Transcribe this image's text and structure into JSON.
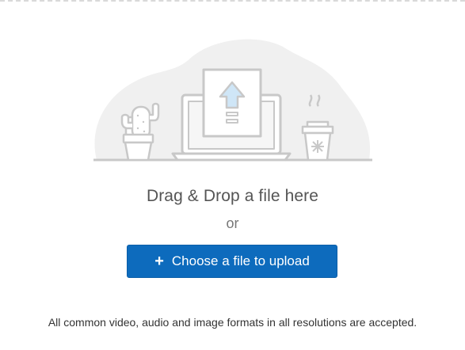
{
  "dropzone": {
    "headline": "Drag & Drop a file here",
    "separator": "or",
    "upload_button_label": "Choose a file to upload",
    "upload_button_icon": "plus-icon",
    "accepted_formats_note": "All common video, audio and image formats in all resolutions are accepted."
  },
  "illustration": {
    "icons": [
      "cactus-icon",
      "laptop-upload-icon",
      "coffee-cup-icon"
    ]
  },
  "colors": {
    "button_bg": "#0d6bbd",
    "button_text": "#ffffff",
    "illustration_bg": "#f0f0f0",
    "illustration_stroke": "#c8c8c8",
    "arrow_accent": "#cfe6f7"
  }
}
